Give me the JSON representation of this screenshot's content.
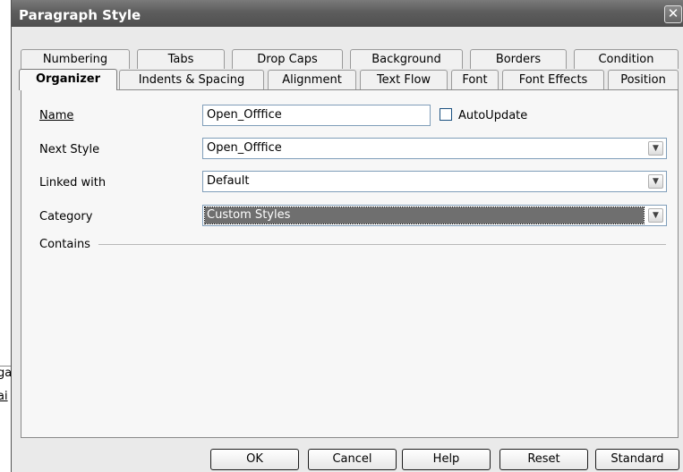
{
  "background_fragment": {
    "line1": "ga",
    "line2": "ai"
  },
  "window": {
    "title": "Paragraph Style",
    "close": "✕"
  },
  "tabs_row1": [
    "Numbering",
    "Tabs",
    "Drop Caps",
    "Background",
    "Borders",
    "Condition"
  ],
  "tabs_row2": [
    "Organizer",
    "Indents & Spacing",
    "Alignment",
    "Text Flow",
    "Font",
    "Font Effects",
    "Position"
  ],
  "organizer": {
    "name_label": "Name",
    "name_value": "Open_Offfice",
    "autoupdate_label": "AutoUpdate",
    "autoupdate_checked": false,
    "next_style_label": "Next Style",
    "next_style_value": "Open_Offfice",
    "linked_with_label": "Linked with",
    "linked_with_value": "Default",
    "category_label": "Category",
    "category_value": "Custom Styles",
    "contains_label": "Contains"
  },
  "buttons": {
    "ok": "OK",
    "cancel": "Cancel",
    "help": "Help",
    "reset": "Reset",
    "standard": "Standard"
  },
  "icons": {
    "dropdown": "chevron-down-icon",
    "close": "close-icon"
  }
}
